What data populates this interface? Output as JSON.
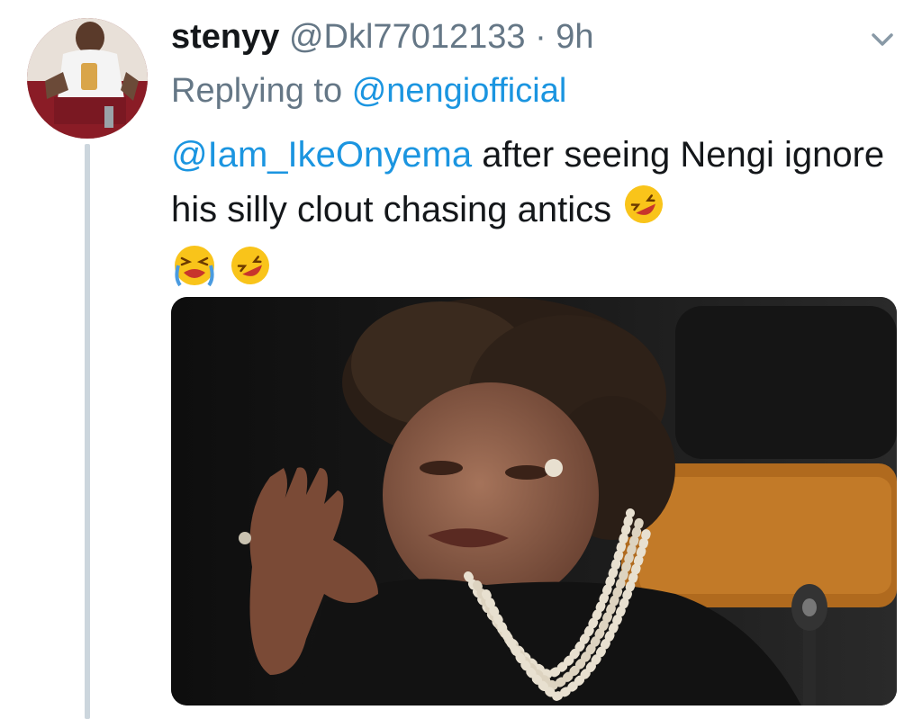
{
  "tweet": {
    "author_name": "stenyy",
    "author_handle": "@Dkl77012133",
    "separator": "·",
    "time": "9h",
    "replying_prefix": "Replying to",
    "replying_to": "@nengiofficial",
    "mention": "@Iam_IkeOnyema",
    "body_text": "after seeing Nengi ignore his silly clout chasing antics"
  },
  "icons": {
    "menu": "chevron-down-icon",
    "emoji_1": "rolling-on-floor-laughing-emoji",
    "emoji_2": "loudly-crying-face-emoji",
    "emoji_3": "rolling-on-floor-laughing-emoji"
  },
  "colors": {
    "link": "#1b95e0",
    "secondary_text": "#657786",
    "primary_text": "#14171a",
    "thread_line": "#ccd6dd"
  }
}
